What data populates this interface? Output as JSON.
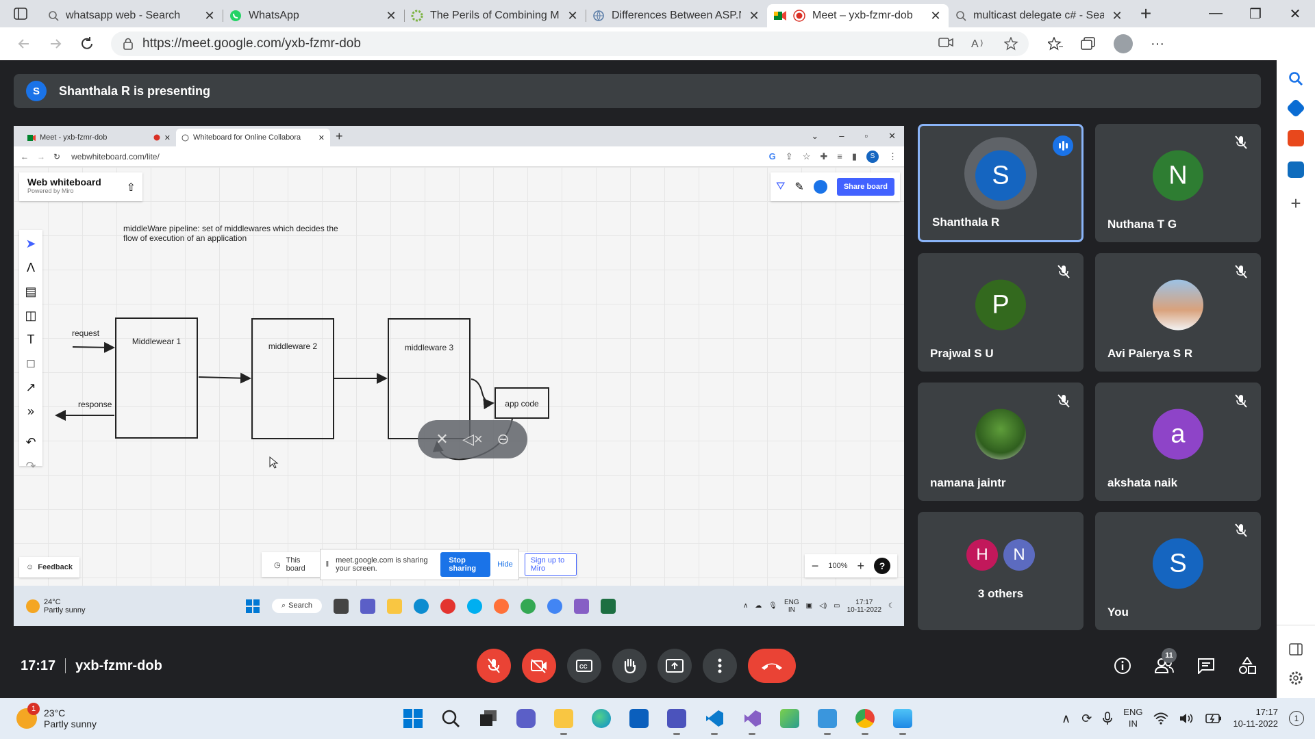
{
  "browser": {
    "tabs": [
      {
        "title": "whatsapp web - Search",
        "icon": "search-icon"
      },
      {
        "title": "WhatsApp",
        "icon": "whatsapp-icon"
      },
      {
        "title": "The Perils of Combining Mu",
        "icon": "gear-icon"
      },
      {
        "title": "Differences Between ASP.N",
        "icon": "web-icon"
      },
      {
        "title": "Meet – yxb-fzmr-dob",
        "icon": "meet-icon"
      },
      {
        "title": "multicast delegate c# - Sear",
        "icon": "search-icon"
      }
    ],
    "url": "https://meet.google.com/yxb-fzmr-dob"
  },
  "meet": {
    "presenter_initial": "S",
    "presenting_text": "Shanthala R is presenting",
    "time": "17:17",
    "meeting_code": "yxb-fzmr-dob",
    "participant_count": "11",
    "participants": [
      {
        "name": "Shanthala R",
        "initial": "S",
        "color": "#1565c0",
        "speaking": true
      },
      {
        "name": "Nuthana T G",
        "initial": "N",
        "color": "#2e7d32",
        "muted": true
      },
      {
        "name": "Prajwal S U",
        "initial": "P",
        "color": "#33691e",
        "muted": true
      },
      {
        "name": "Avi Palerya S R",
        "initial": "",
        "photo": true,
        "muted": true
      },
      {
        "name": "namana jaintr",
        "initial": "",
        "photo": true,
        "muted": true
      },
      {
        "name": "akshata naik",
        "initial": "a",
        "color": "#8e44c8",
        "muted": true
      },
      {
        "name": "You",
        "initial": "S",
        "color": "#1565c0",
        "muted": true
      }
    ],
    "others": {
      "label": "3 others",
      "initials": [
        "H",
        "N"
      ],
      "colors": [
        "#c2185b",
        "#5c6bc0"
      ]
    }
  },
  "shared_screen": {
    "tabs": [
      "Meet - yxb-fzmr-dob",
      "Whiteboard for Online Collabora"
    ],
    "url": "webwhiteboard.com/lite/",
    "profile_initial": "S",
    "whiteboard": {
      "logo_name": "Web whiteboard",
      "logo_sub": "Powered by Miro",
      "share_board": "Share board",
      "note": "middleWare pipeline: set of middlewares which decides the flow of execution of an application",
      "box1": "Middlewear 1",
      "box2": "middleware 2",
      "box3": "middleware 3",
      "box4": "app code",
      "request": "request",
      "response": "response",
      "feedback": "Feedback",
      "zoom": "100%",
      "help": "?",
      "board_note": "This board",
      "sharing_text": "meet.google.com is sharing your screen.",
      "stop_sharing": "Stop sharing",
      "hide": "Hide",
      "signup": "Sign up to Miro"
    },
    "taskbar": {
      "temp": "24°C",
      "weather": "Partly sunny",
      "search": "Search",
      "lang1": "ENG",
      "lang2": "IN",
      "time": "17:17",
      "date": "10-11-2022"
    }
  },
  "taskbar": {
    "temp": "23°C",
    "weather": "Partly sunny",
    "weather_badge": "1",
    "lang1": "ENG",
    "lang2": "IN",
    "time": "17:17",
    "date": "10-11-2022",
    "notif_count": "1"
  }
}
